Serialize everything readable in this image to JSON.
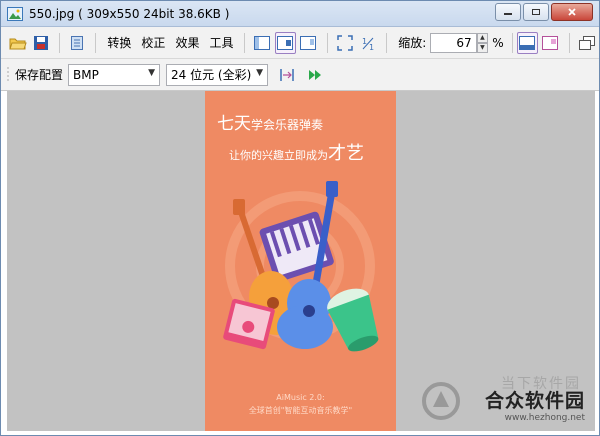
{
  "titlebar": {
    "title": "550.jpg  ( 309x550  24bit  38.6KB )",
    "buttons": [
      "minimize",
      "maximize",
      "close"
    ]
  },
  "toolbar1": {
    "menu": [
      "转换",
      "校正",
      "效果",
      "工具"
    ],
    "zoom_label": "缩放:",
    "zoom_value": "67",
    "zoom_unit": "%"
  },
  "toolbar2": {
    "save_config_label": "保存配置",
    "format_value": "BMP",
    "depth_value": "24 位元 (全彩)"
  },
  "image": {
    "title_big": "七天",
    "title_small": "学会乐器弹奏",
    "subtitle": "让你的兴趣立即成为",
    "subtitle_big": "才艺",
    "footer_line1": "AiMusic 2.0:",
    "footer_line2": "全球首创\"智能互动音乐教学\""
  },
  "watermark": {
    "top_text": "当下软件园",
    "main_text": "合众软件园",
    "url": "www.hezhong.net"
  },
  "colors": {
    "canvas_bg": "#c2c2c2",
    "image_bg": "#ef8a63"
  }
}
